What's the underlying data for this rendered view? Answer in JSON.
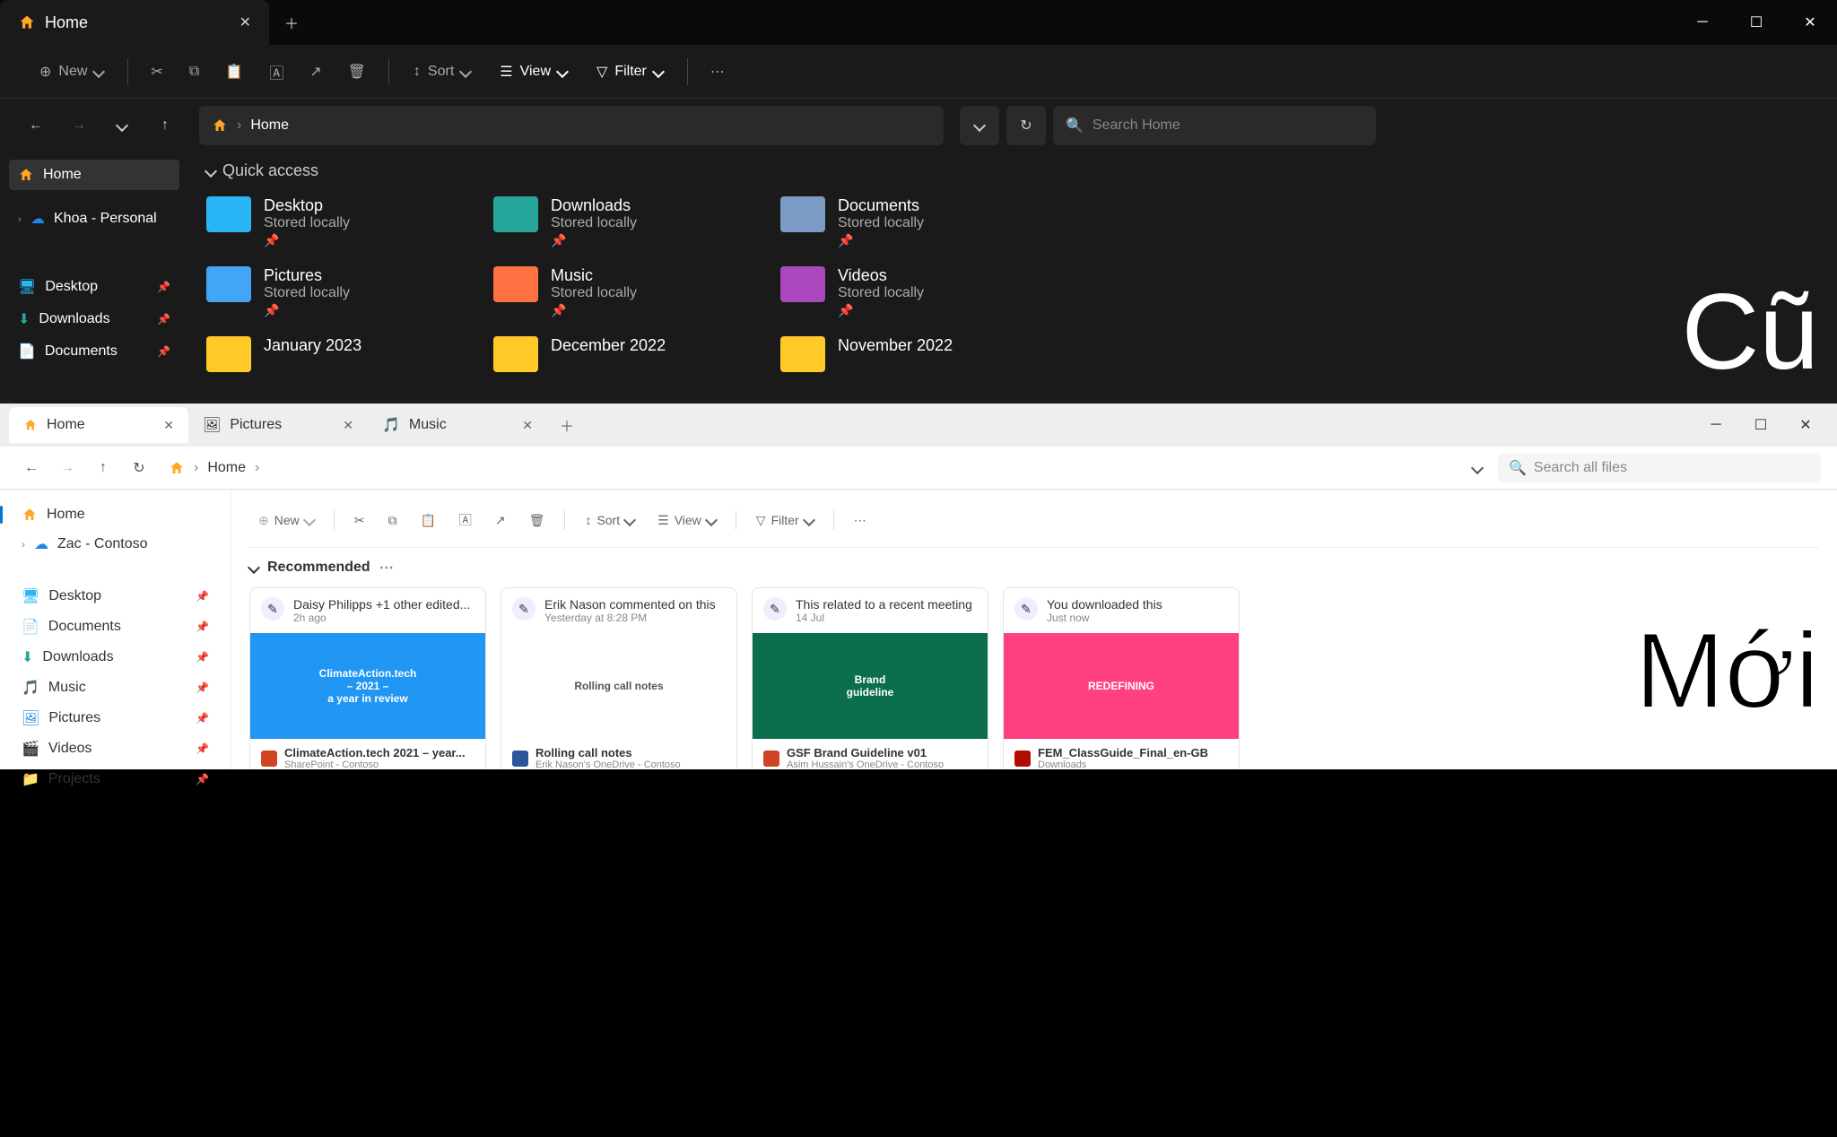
{
  "overlay": {
    "old": "Cũ",
    "new": "Mới"
  },
  "dark": {
    "tab": {
      "title": "Home"
    },
    "toolbar": {
      "new": "New",
      "sort": "Sort",
      "view": "View",
      "filter": "Filter"
    },
    "breadcrumb": "Home",
    "search": {
      "placeholder": "Search Home"
    },
    "sidebar": {
      "home": "Home",
      "onedrive": "Khoa - Personal",
      "items": [
        "Desktop",
        "Downloads",
        "Documents"
      ]
    },
    "section": "Quick access",
    "folders": [
      {
        "name": "Desktop",
        "sub": "Stored locally",
        "color": "#29b6f6"
      },
      {
        "name": "Downloads",
        "sub": "Stored locally",
        "color": "#26a69a"
      },
      {
        "name": "Documents",
        "sub": "Stored locally",
        "color": "#7b9bc4"
      },
      {
        "name": "Pictures",
        "sub": "Stored locally",
        "color": "#42a5f5"
      },
      {
        "name": "Music",
        "sub": "Stored locally",
        "color": "#ff7043"
      },
      {
        "name": "Videos",
        "sub": "Stored locally",
        "color": "#ab47bc"
      },
      {
        "name": "January 2023",
        "sub": "",
        "color": "#ffca28"
      },
      {
        "name": "December 2022",
        "sub": "",
        "color": "#ffca28"
      },
      {
        "name": "November 2022",
        "sub": "",
        "color": "#ffca28"
      }
    ]
  },
  "light": {
    "tabs": [
      {
        "title": "Home",
        "icon": "home"
      },
      {
        "title": "Pictures",
        "icon": "pic"
      },
      {
        "title": "Music",
        "icon": "music"
      }
    ],
    "breadcrumb": "Home",
    "search": {
      "placeholder": "Search all files"
    },
    "sidebar": {
      "home": "Home",
      "onedrive": "Zac - Contoso",
      "items": [
        "Desktop",
        "Documents",
        "Downloads",
        "Music",
        "Pictures",
        "Videos",
        "Projects"
      ]
    },
    "toolbar": {
      "new": "New",
      "sort": "Sort",
      "view": "View",
      "filter": "Filter"
    },
    "section": "Recommended",
    "cards": [
      {
        "head": "Daisy Philipps +1 other edited...",
        "sub": "2h ago",
        "bg": "#2196f3",
        "preview": "ClimateAction.tech\\n– 2021 –\\na year in review",
        "file": "ClimateAction.tech 2021 – year...",
        "loc": "SharePoint - Contoso",
        "ft": "ppt"
      },
      {
        "head": "Erik Nason commented on this",
        "sub": "Yesterday at 8:28 PM",
        "bg": "#ffffff",
        "preview": "Rolling call notes",
        "file": "Rolling call notes",
        "loc": "Erik Nason's OneDrive - Contoso",
        "ft": "doc"
      },
      {
        "head": "This related to a recent meeting",
        "sub": "14 Jul",
        "bg": "#0b6e4f",
        "preview": "Brand\\nguideline",
        "file": "GSF Brand Guideline v01",
        "loc": "Asim Hussain's OneDrive - Contoso",
        "ft": "ppt"
      },
      {
        "head": "You downloaded this",
        "sub": "Just now",
        "bg": "#ff4081",
        "preview": "REDEFINING",
        "file": "FEM_ClassGuide_Final_en-GB",
        "loc": "Downloads",
        "ft": "pdf"
      }
    ]
  }
}
